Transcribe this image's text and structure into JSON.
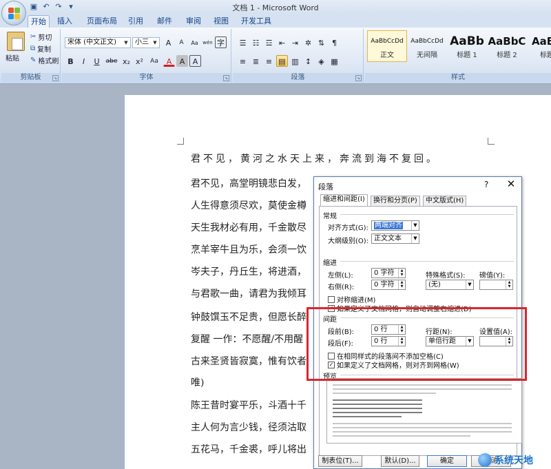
{
  "window": {
    "title": "文档 1 - Microsoft Word"
  },
  "qat": {
    "icons": [
      "save-icon",
      "undo-icon",
      "redo-icon",
      "customize-icon"
    ]
  },
  "tabs": [
    {
      "label": "开始",
      "active": true
    },
    {
      "label": "插入"
    },
    {
      "label": "页面布局"
    },
    {
      "label": "引用"
    },
    {
      "label": "邮件"
    },
    {
      "label": "审阅"
    },
    {
      "label": "视图"
    },
    {
      "label": "开发工具"
    }
  ],
  "ribbon": {
    "clipboard": {
      "label": "剪贴板",
      "paste": "粘贴",
      "cut": "剪切",
      "copy": "复制",
      "format_painter": "格式刷"
    },
    "font": {
      "label": "字体",
      "font_name": "宋体 (中文正文)",
      "font_size": "小三",
      "bold": "B",
      "italic": "I",
      "underline": "U",
      "strike": "abe",
      "sub": "x₂",
      "sup": "x²",
      "grow": "A",
      "shrink": "A",
      "clear": "Aa",
      "color": "A",
      "pinyin": "wén",
      "border": "A",
      "char_shade": "A",
      "enclose": "字"
    },
    "paragraph": {
      "label": "段落"
    },
    "styles": {
      "label": "样式",
      "items": [
        {
          "sample": "AaBbCcDd",
          "name": "正文",
          "selected": true
        },
        {
          "sample": "AaBbCcDd",
          "name": "无间隔"
        },
        {
          "sample": "AaBb",
          "name": "标题 1"
        },
        {
          "sample": "AaBbC",
          "name": "标题 2"
        },
        {
          "sample": "AaBb",
          "name": "标题"
        }
      ]
    }
  },
  "document": {
    "lines": [
      "君不见，黄河之水天上来，奔流到海不复回。",
      "君不见，高堂明镜悲白发，",
      "人生得意须尽欢，莫使金樽",
      "天生我材必有用，千金散尽",
      "烹羊宰牛且为乐，会须一饮",
      "岑夫子，丹丘生，将进酒，",
      "与君歌一曲，请君为我倾耳",
      "钟鼓馔玉不足贵，但愿长醉",
      "复醒 一作：不愿醒/不用醒",
      "古来圣贤皆寂寞，惟有饮者",
      "唯)",
      "陈王昔时宴平乐，斗酒十千",
      "主人何为言少钱，径须沽取",
      "五花马，千金裘，呼儿将出"
    ]
  },
  "dialog": {
    "title": "段落",
    "help": "?",
    "close": "✕",
    "tabs": [
      {
        "label": "缩进和间距(I)",
        "active": true
      },
      {
        "label": "换行和分页(P)"
      },
      {
        "label": "中文版式(H)"
      }
    ],
    "general": {
      "heading": "常规",
      "alignment_label": "对齐方式(G):",
      "alignment_value": "两端对齐",
      "outline_label": "大纲级别(O):",
      "outline_value": "正文文本"
    },
    "indent": {
      "heading": "缩进",
      "left_label": "左侧(L):",
      "left_value": "0 字符",
      "right_label": "右侧(R):",
      "right_value": "0 字符",
      "special_label": "特殊格式(S):",
      "special_value": "(无)",
      "by_label": "磅值(Y):",
      "by_value": "",
      "mirror_label": "对称缩进(M)",
      "mirror_checked": false,
      "auto_label": "如果定义了文档网格，则自动调整右缩进(D)",
      "auto_checked": true
    },
    "spacing": {
      "heading": "间距",
      "before_label": "段前(B):",
      "before_value": "0 行",
      "after_label": "段后(F):",
      "after_value": "0 行",
      "line_label": "行距(N):",
      "line_value": "单倍行距",
      "at_label": "设置值(A):",
      "at_value": "",
      "no_space_label": "在相同样式的段落间不添加空格(C)",
      "no_space_checked": false,
      "snap_label": "如果定义了文档网格，则对齐到网格(W)",
      "snap_checked": true
    },
    "preview": {
      "heading": "预览"
    },
    "buttons": {
      "tabs": "制表位(T)...",
      "default": "默认(D)...",
      "ok": "确定",
      "cancel": "取消"
    }
  },
  "watermark": {
    "text": "系统天地"
  },
  "colors": {
    "highlight": "#d8262e",
    "selection": "#3a78d6",
    "ribbon_text": "#15428b"
  }
}
